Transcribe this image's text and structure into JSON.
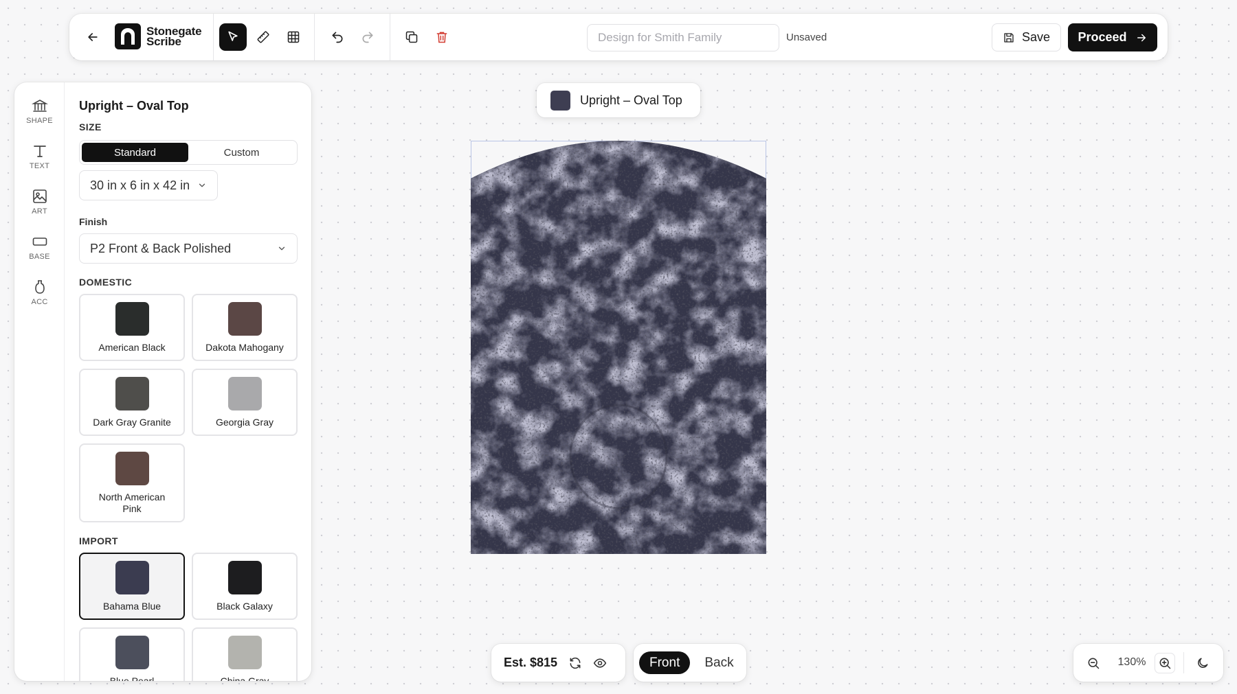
{
  "toolbar": {
    "brand_line1": "Stonegate",
    "brand_line2": "Scribe",
    "title_placeholder": "Design for Smith Family",
    "title_value": "",
    "status": "Unsaved",
    "save_label": "Save",
    "proceed_label": "Proceed"
  },
  "rail": {
    "items": [
      {
        "label": "SHAPE",
        "icon": "monument-icon"
      },
      {
        "label": "TEXT",
        "icon": "text-icon"
      },
      {
        "label": "ART",
        "icon": "image-icon"
      },
      {
        "label": "BASE",
        "icon": "base-icon"
      },
      {
        "label": "ACC",
        "icon": "vase-icon"
      }
    ]
  },
  "panel": {
    "title": "Upright – Oval Top",
    "size_label": "SIZE",
    "size_tabs": [
      "Standard",
      "Custom"
    ],
    "size_value": "30 in x 6 in x 42 in",
    "finish_label": "Finish",
    "finish_value": "P2 Front & Back Polished",
    "domestic_label": "DOMESTIC",
    "domestic": [
      {
        "name": "American Black",
        "color": "#2a2d2c"
      },
      {
        "name": "Dakota Mahogany",
        "color": "#5b4745"
      },
      {
        "name": "Dark Gray Granite",
        "color": "#4f4e4b"
      },
      {
        "name": "Georgia Gray",
        "color": "#a9a9ab"
      },
      {
        "name": "North American Pink",
        "color": "#5e4843"
      }
    ],
    "import_label": "IMPORT",
    "import": [
      {
        "name": "Bahama Blue",
        "color": "#3b3c50"
      },
      {
        "name": "Black Galaxy",
        "color": "#1d1d1f"
      },
      {
        "name": "Blue Pearl",
        "color": "#4c4f5c"
      },
      {
        "name": "China Gray",
        "color": "#b3b3ae"
      }
    ]
  },
  "canvas": {
    "shape_chip_label": "Upright – Oval Top",
    "stone_color": "#35364a"
  },
  "bottom": {
    "estimate": "Est. $815",
    "sides": [
      "Front",
      "Back"
    ],
    "zoom": "130%"
  }
}
